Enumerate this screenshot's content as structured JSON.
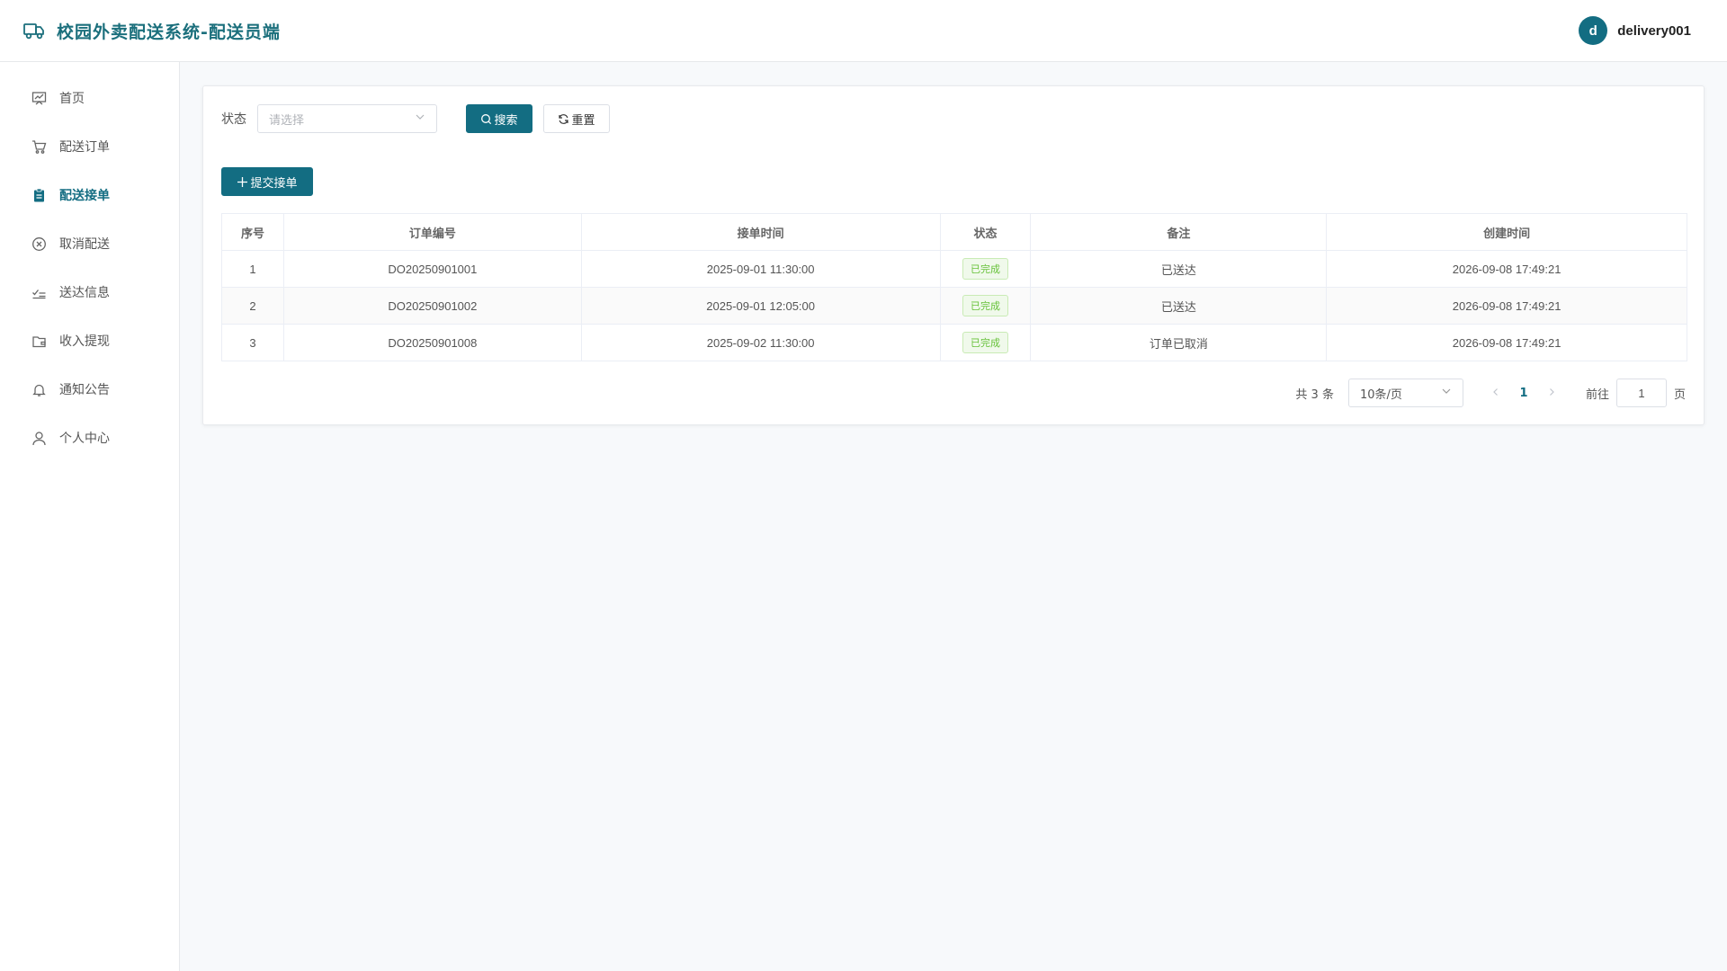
{
  "header": {
    "title": "校园外卖配送系统-配送员端",
    "logo_icon": "truck-icon",
    "avatar_letter": "d",
    "username": "delivery001",
    "accent_color": "#136d82"
  },
  "sidebar": {
    "items": [
      {
        "label": "首页",
        "icon": "home-icon",
        "active": false
      },
      {
        "label": "配送订单",
        "icon": "cart-icon",
        "active": false
      },
      {
        "label": "配送接单",
        "icon": "clipboard-icon",
        "active": true
      },
      {
        "label": "取消配送",
        "icon": "cancel-circle-icon",
        "active": false
      },
      {
        "label": "送达信息",
        "icon": "checklist-icon",
        "active": false
      },
      {
        "label": "收入提现",
        "icon": "wallet-icon",
        "active": false
      },
      {
        "label": "通知公告",
        "icon": "bell-icon",
        "active": false
      },
      {
        "label": "个人中心",
        "icon": "user-icon",
        "active": false
      }
    ]
  },
  "filter": {
    "status_label": "状态",
    "status_placeholder": "请选择",
    "search_label": "搜索",
    "reset_label": "重置"
  },
  "actions": {
    "add_label": "提交接单"
  },
  "table": {
    "columns": [
      "序号",
      "订单编号",
      "接单时间",
      "状态",
      "备注",
      "创建时间"
    ],
    "rows": [
      {
        "index": "1",
        "order_no": "DO20250901001",
        "accept_time": "2025-09-01 11:30:00",
        "status": "已完成",
        "remark": "已送达",
        "created": "2026-09-08 17:49:21"
      },
      {
        "index": "2",
        "order_no": "DO20250901002",
        "accept_time": "2025-09-01 12:05:00",
        "status": "已完成",
        "remark": "已送达",
        "created": "2026-09-08 17:49:21"
      },
      {
        "index": "3",
        "order_no": "DO20250901008",
        "accept_time": "2025-09-02 11:30:00",
        "status": "已完成",
        "remark": "订单已取消",
        "created": "2026-09-08 17:49:21"
      }
    ]
  },
  "pagination": {
    "total_text": "共 3 条",
    "page_size": "10条/页",
    "current_page": "1",
    "goto_label": "前往",
    "goto_value": "1",
    "page_suffix": "页"
  }
}
